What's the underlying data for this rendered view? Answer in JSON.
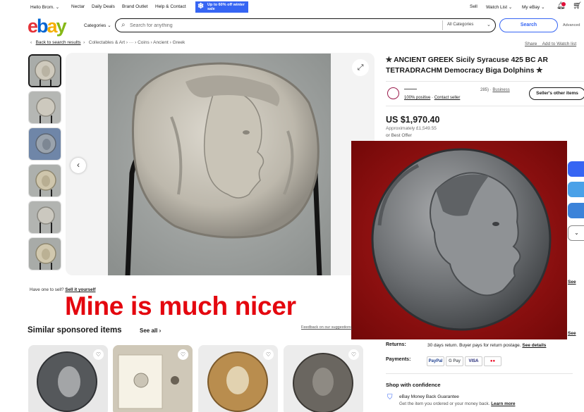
{
  "topbar": {
    "greeting": "Hello Brom.",
    "links": [
      "Nectar",
      "Daily Deals",
      "Brand Outlet",
      "Help & Contact"
    ],
    "promo": "Up to 60% off winter sale",
    "sell": "Sell",
    "watch_list": "Watch List",
    "my_ebay": "My eBay"
  },
  "header": {
    "logo": [
      "e",
      "b",
      "a",
      "y"
    ],
    "categories": "Categories",
    "search_placeholder": "Search for anything",
    "all_categories": "All Categories",
    "search_button": "Search",
    "advanced": "Advanced"
  },
  "breadcrumb": {
    "back": "Back to search results",
    "path": "Collectables & Art  ›  ···  ›  Coins  ›  Ancient  ›  Greek",
    "share": "Share",
    "watch": "Add to Watch list"
  },
  "listing": {
    "title": "✯ ANCIENT GREEK Sicily Syracuse 425 BC AR TETRADRACHM Democracy Biga Dolphins ✯",
    "seller_positive": "100% positive",
    "contact_seller": "Contact seller",
    "feedback_count": "285)",
    "seller_type": "Business",
    "other_items": "Seller's other items",
    "price": "US $1,970.40",
    "approx": "Approximately £1,549.55",
    "best_offer": "or Best Offer"
  },
  "gallery": {
    "sell_question": "Have one to sell?",
    "sell_link": "Sell it yourself"
  },
  "annotation": {
    "text": "Mine is much nicer"
  },
  "right_partial": {
    "see1": "See",
    "see2": "See"
  },
  "similar": {
    "heading": "Similar sponsored items",
    "see_all": "See all",
    "feedback": "Feedback on our suggestions"
  },
  "returns": {
    "label": "Returns:",
    "text": "30 days return. Buyer pays for return postage.",
    "link": "See details"
  },
  "payments": {
    "label": "Payments:",
    "methods": [
      "PayPal",
      "G Pay",
      "VISA",
      "●●"
    ]
  },
  "shop_confidence": {
    "heading": "Shop with confidence",
    "title": "eBay Money Back Guarantee",
    "text": "Get the item you ordered or your money back.",
    "link": "Learn more"
  },
  "colors": {
    "accent": "#3665f3",
    "annotation_red": "#e4070f"
  }
}
